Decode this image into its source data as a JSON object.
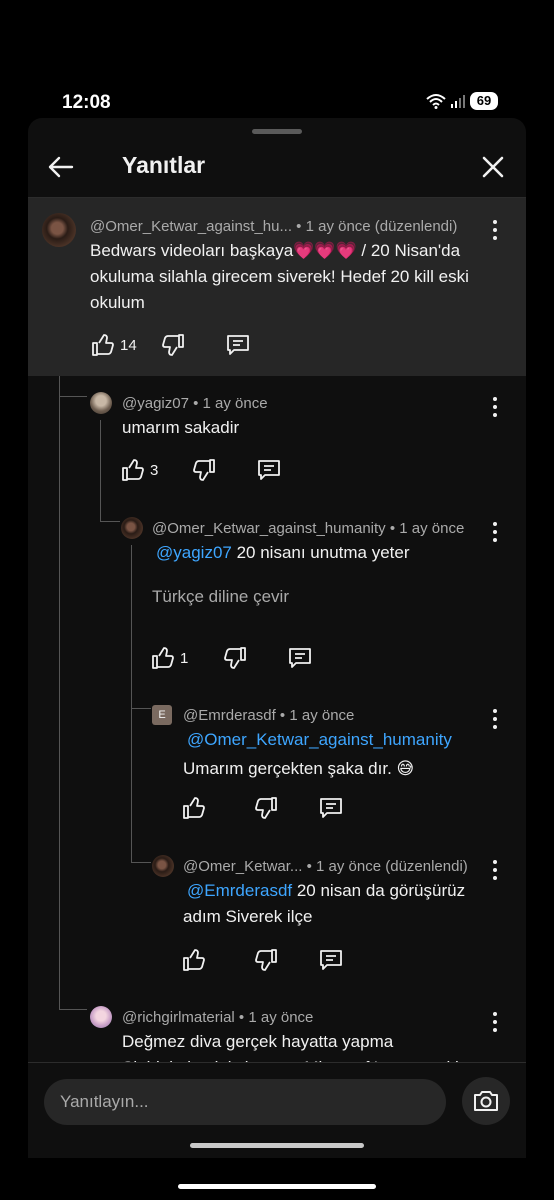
{
  "status": {
    "time": "12:08",
    "battery": "69",
    "icons": [
      "wifi-icon",
      "signal-icon",
      "battery-icon"
    ]
  },
  "header": {
    "title": "Yanıtlar",
    "back_icon": "arrow-left-icon",
    "close_icon": "close-icon"
  },
  "colors": {
    "background": "#0f0f0f",
    "highlight": "#262626",
    "mention": "#3ea6ff",
    "text": "#f1f1f1",
    "muted": "#aaaaaa"
  },
  "comments": [
    {
      "author": "@Omer_Ketwar_against_hu...",
      "meta": " • 1 ay önce (düzenlendi)",
      "text": "Bedwars videoları başkaya💗💗💗 / 20 Nisan'da okuluma silahla girecem siverek! Hedef 20 kill eski okulum",
      "likes": "14"
    },
    {
      "author": "@yagiz07",
      "meta": " • 1 ay önce",
      "text": "umarım sakadir",
      "likes": "3"
    },
    {
      "author": "@Omer_Ketwar_against_humanity",
      "meta": " • 1 ay önce",
      "mention": "@yagiz07",
      "text": " 20 nisanı unutma yeter",
      "translate": "Türkçe diline çevir",
      "likes": "1"
    },
    {
      "author": "@Emrderasdf",
      "meta": " • 1 ay önce",
      "avatar_letter": "E",
      "mention": "@Omer_Ketwar_against_humanity",
      "text": "Umarım gerçekten şaka dır. 😅",
      "likes": ""
    },
    {
      "author": "@Omer_Ketwar...",
      "meta": " • 1 ay önce (düzenlendi)",
      "mention": "@Emrderasdf",
      "text": " 20 nisan da görüşürüz adım Siverek ilçe",
      "likes": ""
    },
    {
      "author": "@richgirlmaterial",
      "meta": " • 1 ay önce",
      "text": "Değmez diva gerçek hayatta yapma",
      "text_cut": "Sinirini almak istiyorsan Minecraft'ta yap eski"
    }
  ],
  "composer": {
    "placeholder": "Yanıtlayın...",
    "camera_icon": "camera-icon"
  }
}
